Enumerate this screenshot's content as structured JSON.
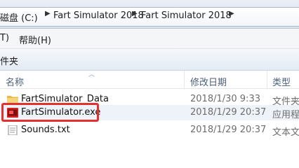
{
  "address_bar": {
    "crumbs": [
      "磁盘 (C:)",
      "Fart Simulator 2018",
      "Fart Simulator 2018"
    ]
  },
  "menu": {
    "items": [
      "T)",
      "帮助(H)"
    ]
  },
  "toolbar": {
    "label": "件夹"
  },
  "columns": {
    "name": "名称",
    "date": "修改日期",
    "type": "类型"
  },
  "files": [
    {
      "name": "FartSimulator_Data",
      "date": "2018/1/30 9:33",
      "type": "文件夹",
      "icon": "folder-icon"
    },
    {
      "name": "FartSimulator.exe",
      "date": "2018/1/29 20:37",
      "type": "应用程",
      "icon": "exe-icon",
      "selected": true,
      "highlighted": true
    },
    {
      "name": "Sounds.txt",
      "date": "2018/1/29 20:37",
      "type": "文本文",
      "icon": "text-file-icon"
    }
  ],
  "colors": {
    "highlight_box": "#e53030",
    "header_text": "#4c607a",
    "secondary_text": "#6d6d6d"
  }
}
